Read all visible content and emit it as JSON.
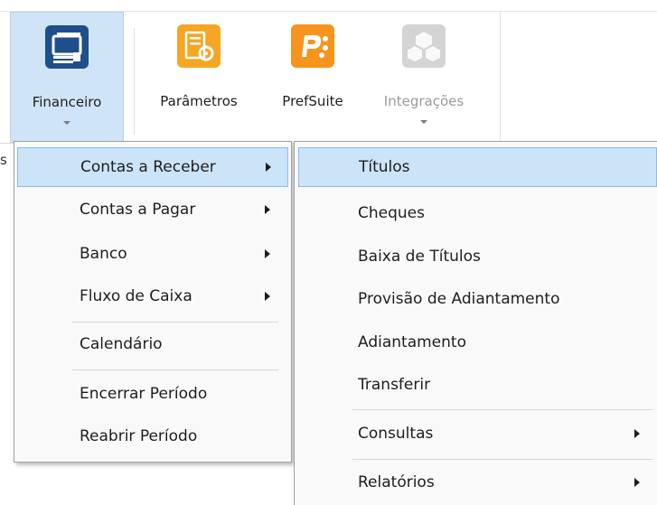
{
  "ribbon": {
    "buttons": [
      {
        "label": "Financeiro"
      },
      {
        "label": "Parâmetros"
      },
      {
        "label": "PrefSuite"
      },
      {
        "label": "Integrações"
      }
    ]
  },
  "left_stub": "s",
  "menu": {
    "items": [
      {
        "label": "Contas a Receber"
      },
      {
        "label": "Contas a Pagar"
      },
      {
        "label": "Banco"
      },
      {
        "label": "Fluxo de Caixa"
      },
      {
        "label": "Calendário"
      },
      {
        "label": "Encerrar Período"
      },
      {
        "label": "Reabrir Período"
      }
    ]
  },
  "submenu": {
    "items": [
      {
        "label": "Títulos"
      },
      {
        "label": "Cheques"
      },
      {
        "label": "Baixa de Títulos"
      },
      {
        "label": "Provisão de Adiantamento"
      },
      {
        "label": "Adiantamento"
      },
      {
        "label": "Transferir"
      },
      {
        "label": "Consultas"
      },
      {
        "label": "Relatórios"
      }
    ]
  },
  "colors": {
    "highlight": "#cce4f7",
    "financeiro_icon": "#1f4f8a",
    "parametros_icon": "#f5a623",
    "prefsuite_icon": "#f7941d"
  }
}
